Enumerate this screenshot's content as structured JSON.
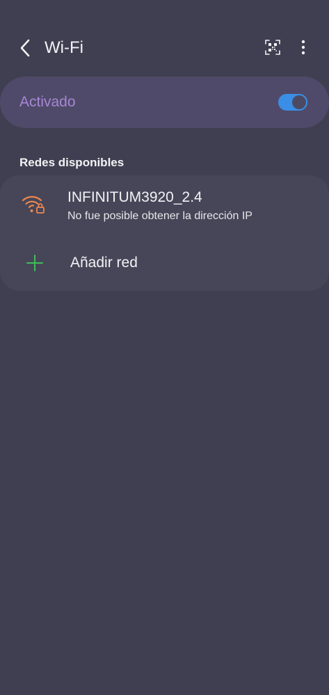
{
  "header": {
    "title": "Wi-Fi",
    "back_icon": "chevron-left-icon",
    "qr_icon": "qr-code-scan-icon",
    "more_icon": "more-vertical-icon"
  },
  "wifi_toggle": {
    "label": "Activado",
    "state": "on",
    "label_color": "#a787d6",
    "accent_color": "#3a8ee6"
  },
  "available_networks": {
    "section_title": "Redes disponibles",
    "networks": [
      {
        "name": "INFINITUM3920_2.4",
        "status": "No fue posible obtener la dirección IP",
        "icon": "wifi-locked-warning-icon",
        "icon_color": "#ee8750"
      }
    ],
    "add_network": {
      "label": "Añadir red",
      "icon": "plus-icon",
      "icon_color": "#3fbf57"
    }
  }
}
